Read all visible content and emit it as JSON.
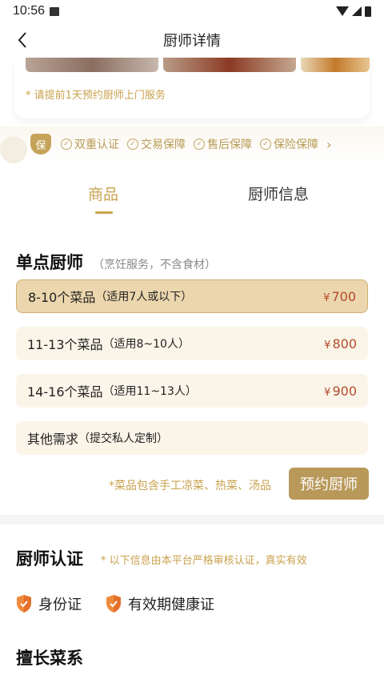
{
  "status_bar": {
    "time": "10:56"
  },
  "header": {
    "title": "厨师详情"
  },
  "notice": "* 请提前1天预约厨师上门服务",
  "guarantees": {
    "badge": "保",
    "items": [
      "双重认证",
      "交易保障",
      "售后保障",
      "保险保障"
    ]
  },
  "tabs": [
    {
      "label": "商品",
      "active": true
    },
    {
      "label": "厨师信息",
      "active": false
    }
  ],
  "single_chef": {
    "title": "单点厨师",
    "subtitle": "（烹饪服务，不含食材）",
    "options": [
      {
        "main": "8-10个菜品",
        "note": "（适用7人或以下）",
        "currency": "¥",
        "price": "700",
        "selected": true
      },
      {
        "main": "11-13个菜品",
        "note": "（适用8~10人）",
        "currency": "¥",
        "price": "800",
        "selected": false
      },
      {
        "main": "14-16个菜品",
        "note": "（适用11~13人）",
        "currency": "¥",
        "price": "900",
        "selected": false
      },
      {
        "main": "其他需求",
        "note": "（提交私人定制）",
        "currency": "",
        "price": "",
        "selected": false
      }
    ],
    "footer_note": "*菜品包含手工凉菜、热菜、汤品",
    "book_button": "预约厨师"
  },
  "certification": {
    "title": "厨师认证",
    "note": "* 以下信息由本平台严格审核认证，真实有效",
    "items": [
      "身份证",
      "有效期健康证"
    ]
  },
  "cuisine": {
    "title": "擅长菜系"
  },
  "colors": {
    "accent": "#c9a24d",
    "price": "#b44a2b",
    "selected_bg": "#ecd6ae",
    "option_bg": "#fbf5e9",
    "button": "#b9995a"
  }
}
